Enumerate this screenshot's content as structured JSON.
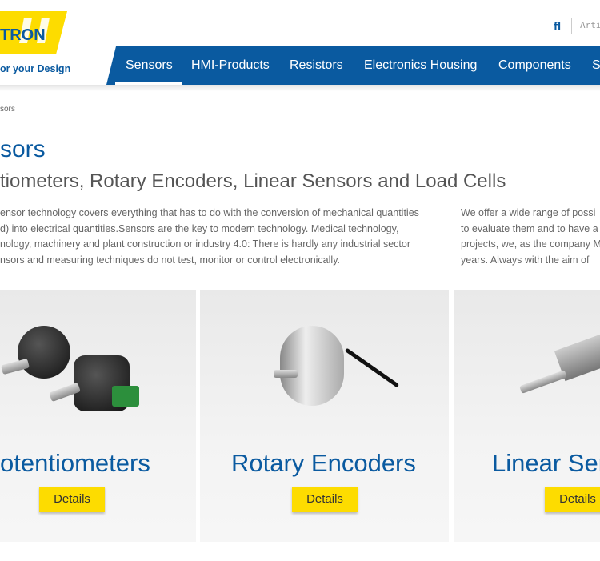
{
  "brand": {
    "logo_text": "TRON",
    "tagline": "or your Design",
    "colors": {
      "primary": "#0a5aa0",
      "accent": "#fddc00"
    }
  },
  "header": {
    "language_icon_text": "fl",
    "search_placeholder": "Arti"
  },
  "nav": {
    "items": [
      {
        "label": "Sensors",
        "active": true
      },
      {
        "label": "HMI-Products"
      },
      {
        "label": "Resistors"
      },
      {
        "label": "Electronics Housing"
      },
      {
        "label": "Components"
      },
      {
        "label": "S"
      }
    ]
  },
  "breadcrumb": "sors",
  "page": {
    "title": "sors",
    "subtitle": "tiometers, Rotary Encoders, Linear Sensors and Load Cells",
    "intro_left": [
      "ensor technology covers everything that has to do with the conversion of mechanical quantities",
      "d) into electrical quantities.Sensors are the key to modern technology. Medical technology,",
      "nology, machinery and plant construction or industry 4.0: There is hardly any industrial sector",
      "nsors and measuring techniques do not test, monitor or control electronically."
    ],
    "intro_right": [
      "We offer a wide range of possi",
      "to evaluate them and to have a",
      "projects, we, as the company M",
      "years. Always with the aim of"
    ]
  },
  "cards": [
    {
      "title": "otentiometers",
      "button": "Details"
    },
    {
      "title": "Rotary Encoders",
      "button": "Details"
    },
    {
      "title": "Linear Ser",
      "button": "Details"
    }
  ]
}
